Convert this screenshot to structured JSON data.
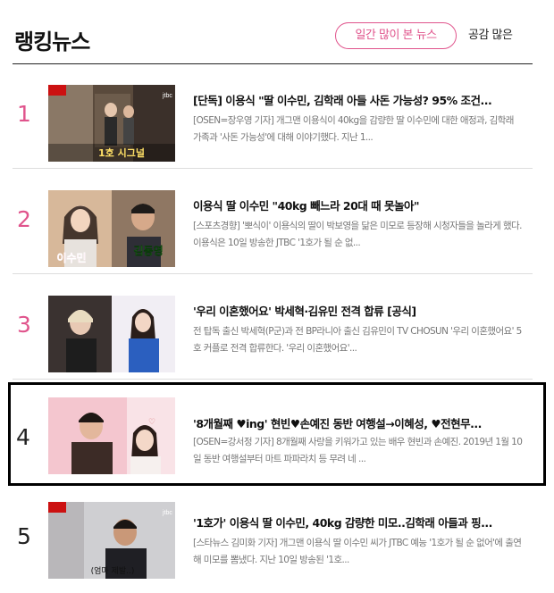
{
  "header": {
    "title": "랭킹뉴스",
    "tab_active": "일간 많이 본 뉴스",
    "tab_other": "공감 많은"
  },
  "colors": {
    "accent": "#e0548c",
    "divider": "#dddddd"
  },
  "items": [
    {
      "rank": "1",
      "headline": "[단독] 이용식 \"딸 이수민, 김학래 아들 사돈 가능성? 95% 조건...",
      "snippet": "[OSEN=장우영 기자] 개그맨 이용식이 40kg을 감량한 딸 이수민에 대한 애정과, 김학래 가족과 '사돈 가능성'에 대해 이야기했다. 지난 1...",
      "thumb_caption": "1호 시그널",
      "thumb_label": "jtbc"
    },
    {
      "rank": "2",
      "headline": "이용식 딸 이수민 \"40kg 빼느라 20대 때 못놀아\"",
      "snippet": "[스포츠경향] '뽀식이' 이용식의 딸이 박보영을 닮은 미모로 등장해 시청자들을 놀라게 했다. 이용식은 10일 방송한 JTBC '1호가 될 순 없...",
      "thumb_name_left": "이수민",
      "thumb_name_right": "김동영"
    },
    {
      "rank": "3",
      "headline": "'우리 이혼했어요' 박세혁·김유민 전격 합류 [공식]",
      "snippet": "전 탑독 출신 박세혁(P군)과 전 BP라니아 출신 김유민이 TV CHOSUN '우리 이혼했어요' 5호 커플로 전격 합류한다. '우리 이혼했어요'..."
    },
    {
      "rank": "4",
      "headline": "'8개월째 ♥ing' 현빈♥손예진 동반 여행설→이혜성, ♥전현무...",
      "snippet": "[OSEN=강서정 기자] 8개월째 사랑을 키워가고 있는 배우 현빈과 손예진. 2019년 1월 10일 동반 여행설부터 마트 파파라치 등 무려 네 ...",
      "highlighted": true
    },
    {
      "rank": "5",
      "headline": "'1호가' 이용식 딸 이수민, 40kg 감량한 미모..김학래 아들과 핑...",
      "snippet": "[스타뉴스 김미화 기자] 개그맨 이용식 딸 이수민 씨가 JTBC 예능 '1호가 될 순 없어'에 출연해 미모를 뽐냈다. 지난 10일 방송된 '1호...",
      "thumb_caption": "(엄마 제발..)",
      "thumb_label": "jtbc"
    }
  ]
}
